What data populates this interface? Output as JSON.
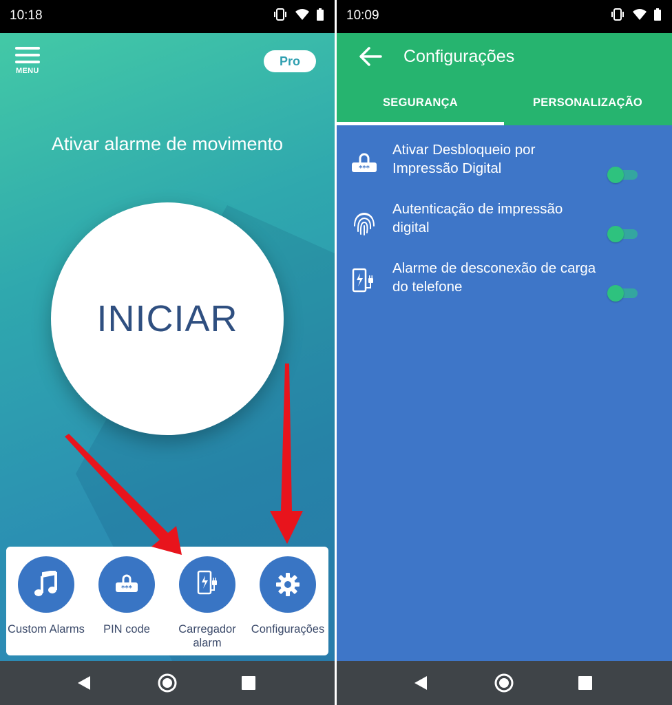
{
  "left": {
    "status": {
      "time": "10:18"
    },
    "menu": {
      "label": "MENU"
    },
    "pro": {
      "label": "Pro"
    },
    "headline": "Ativar alarme de movimento",
    "start": {
      "label": "INICIAR"
    },
    "actions": [
      {
        "label": "Custom Alarms",
        "icon": "music-note-icon"
      },
      {
        "label": "PIN code",
        "icon": "pin-keypad-icon"
      },
      {
        "label": "Carregador alarm",
        "icon": "charger-icon"
      },
      {
        "label": "Configurações",
        "icon": "gear-icon"
      }
    ]
  },
  "right": {
    "status": {
      "time": "10:09"
    },
    "appbar": {
      "title": "Configurações"
    },
    "tabs": [
      {
        "label": "SEGURANÇA",
        "active": true
      },
      {
        "label": "PERSONALIZAÇÃO",
        "active": false
      }
    ],
    "settings": [
      {
        "label": "Ativar Desbloqueio por Impressão Digital",
        "icon": "pin-lock-icon",
        "enabled": true
      },
      {
        "label": "Autenticação de impressão digital",
        "icon": "fingerprint-icon",
        "enabled": true
      },
      {
        "label": "Alarme de desconexão de carga do telefone",
        "icon": "charger-icon",
        "enabled": true
      }
    ]
  },
  "colors": {
    "accent_green": "#26b46f",
    "settings_blue": "#3e76c8",
    "action_blue": "#3975c4",
    "arrow_red": "#e8141c"
  }
}
